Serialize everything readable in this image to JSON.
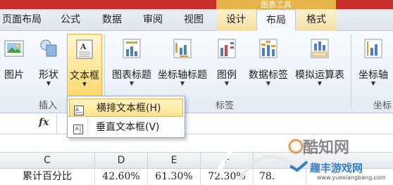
{
  "context_tab_title": "图表工具",
  "tabs": [
    {
      "label": "页面布局"
    },
    {
      "label": "公式"
    },
    {
      "label": "数据"
    },
    {
      "label": "审阅"
    },
    {
      "label": "视图"
    },
    {
      "label": "设计"
    },
    {
      "label": "布局"
    },
    {
      "label": "格式"
    }
  ],
  "ribbon": {
    "buttons": {
      "picture": "图片",
      "shapes": "形状",
      "textbox": "文本框",
      "chart_title": "图表标题",
      "axis_title": "坐标轴标题",
      "legend": "图例",
      "data_labels": "数据标签",
      "data_table": "模拟运算表",
      "axes": "坐标轴"
    },
    "groups": {
      "insert": "插入",
      "labels": "标签",
      "axes": "坐标"
    }
  },
  "formula_bar": {
    "fx": "fx"
  },
  "columns": [
    "C",
    "D",
    "E",
    "F"
  ],
  "row_values": {
    "c": "累计百分比",
    "d": "42.60%",
    "e": "61.30%",
    "f": "72.30%",
    "g": "78."
  },
  "textbox_menu": {
    "items": [
      {
        "label": "横排文本框(H)"
      },
      {
        "label": "垂直文本框(V)"
      }
    ]
  },
  "watermark": {
    "brand": "酷知网",
    "brand2": "趣丰游戏网",
    "url": "www.yuexiangbang.com"
  }
}
